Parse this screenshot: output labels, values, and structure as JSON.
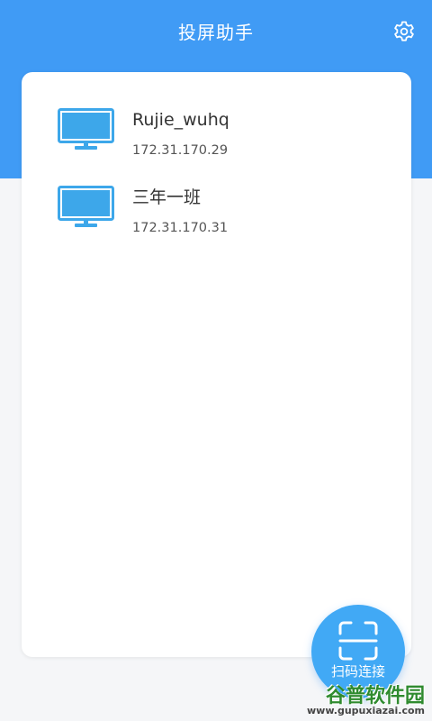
{
  "header": {
    "title": "投屏助手",
    "settings_icon": "gear-icon",
    "background_color": "#409bf5"
  },
  "devices": [
    {
      "name": "Rujie_wuhq",
      "ip": "172.31.170.29",
      "icon": "monitor-icon"
    },
    {
      "name": "三年一班",
      "ip": "172.31.170.31",
      "icon": "monitor-icon"
    }
  ],
  "fab": {
    "label": "扫码连接",
    "icon": "scan-icon",
    "color": "#41a9f5"
  },
  "watermark": {
    "text": "谷普软件园",
    "url": "www.gupuxiazai.com"
  },
  "colors": {
    "accent": "#409bf5",
    "monitor": "#3da7ea"
  }
}
